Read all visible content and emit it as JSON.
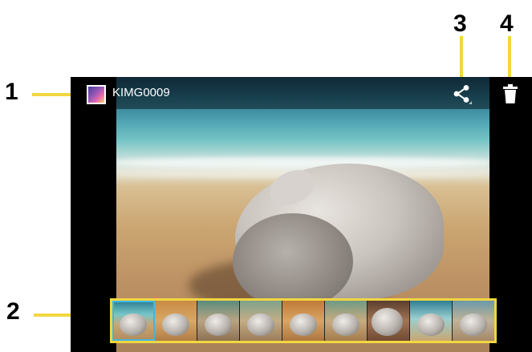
{
  "callouts": {
    "c1": "1",
    "c2": "2",
    "c3": "3",
    "c4": "4"
  },
  "topbar": {
    "title": "KIMG0009",
    "app_icon": "gallery-app-icon",
    "share_icon": "share-icon",
    "delete_icon": "trash-icon"
  },
  "filmstrip": {
    "count": 9,
    "selected_index": 0,
    "selected_color": "#3db7e4"
  },
  "colors": {
    "callout_highlight": "#f2d640"
  }
}
